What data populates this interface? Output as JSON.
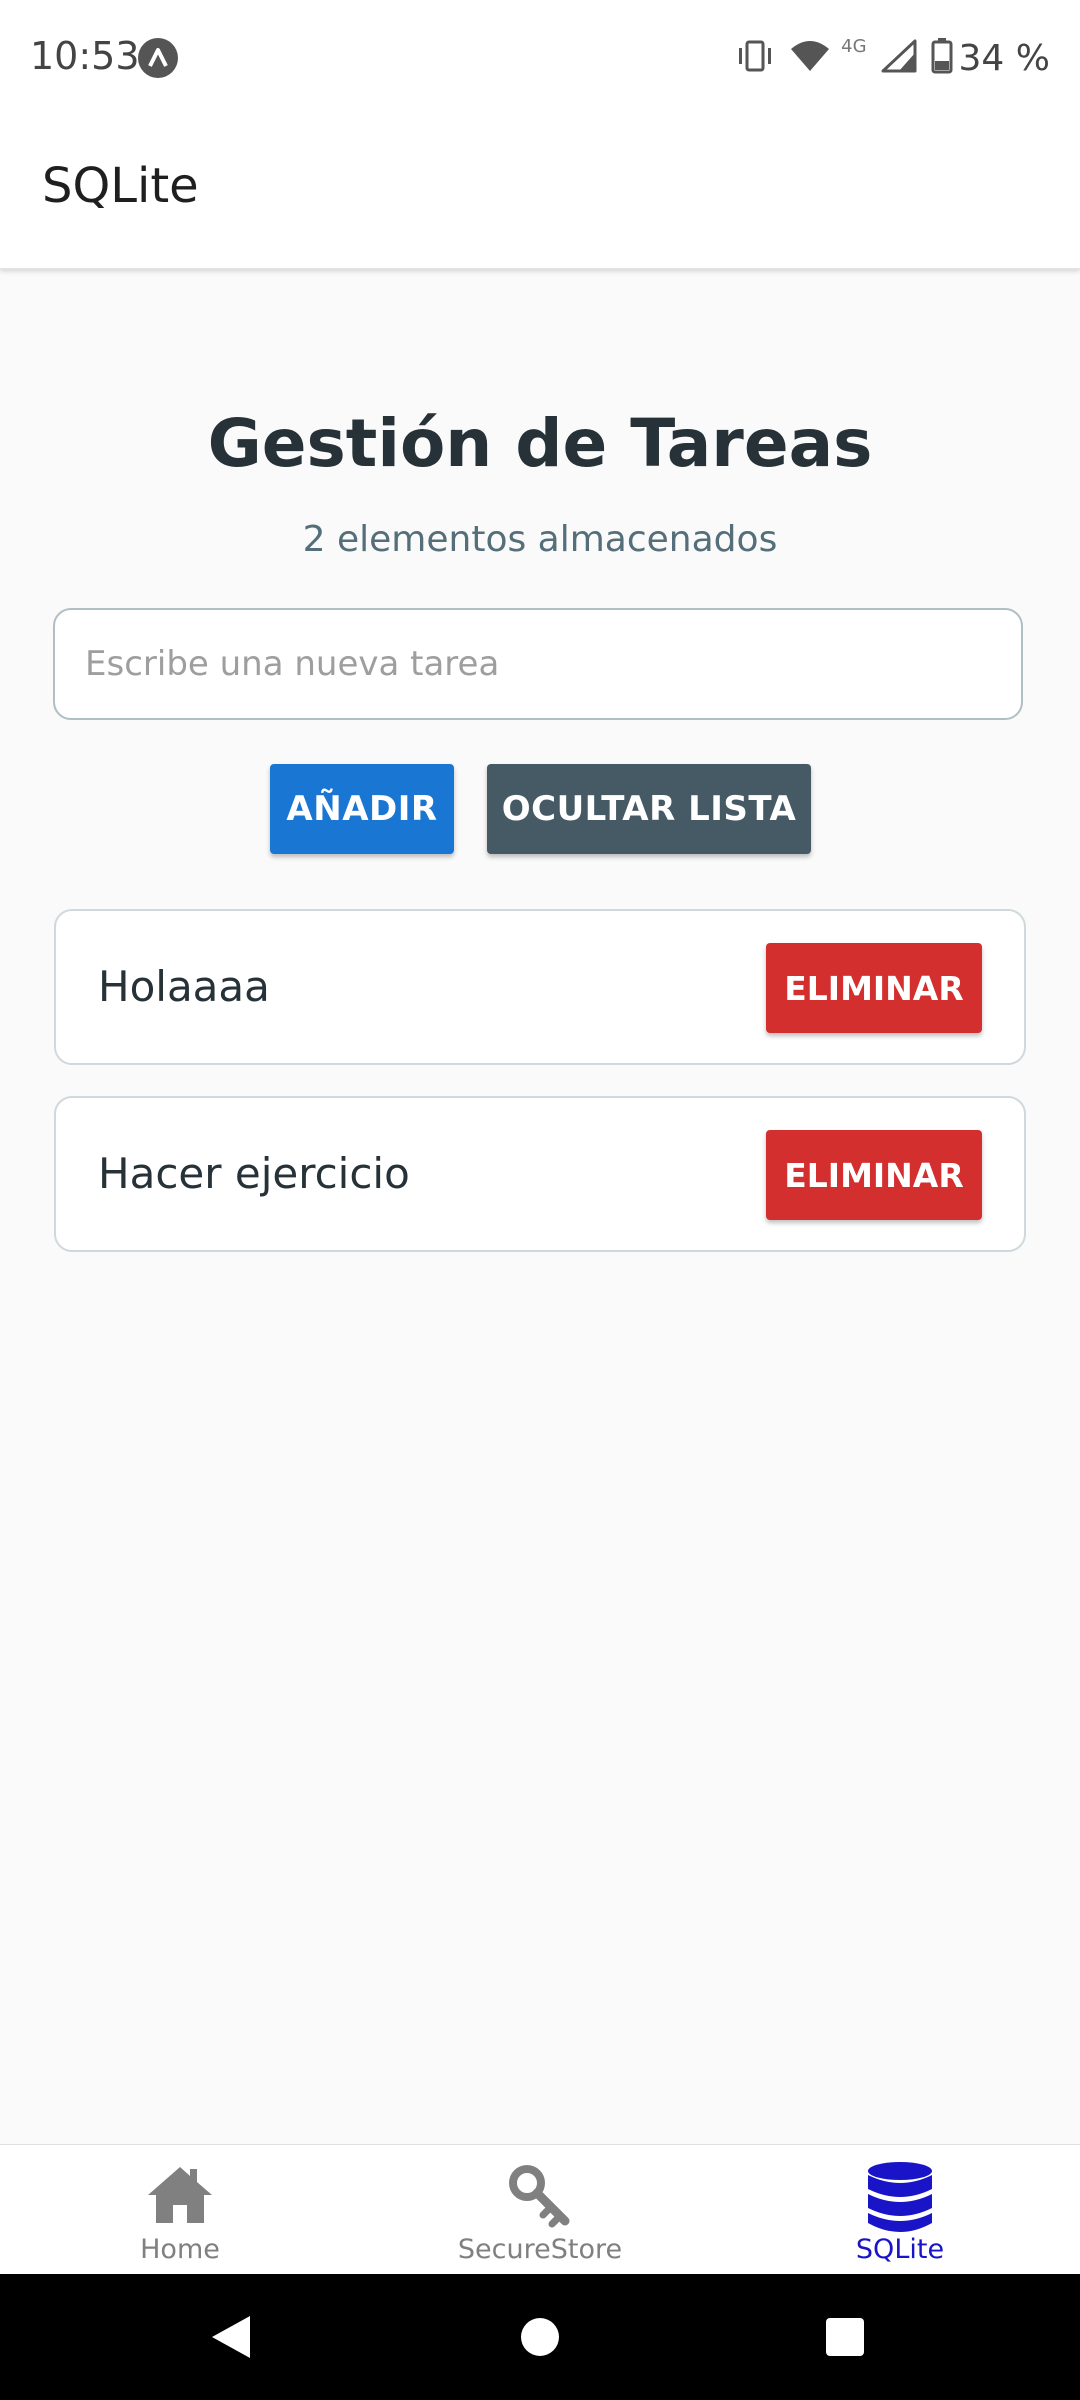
{
  "status_bar": {
    "time": "10:53",
    "network": "4G",
    "battery": "34 %"
  },
  "app_bar": {
    "title": "SQLite"
  },
  "main": {
    "title": "Gestión de Tareas",
    "subtitle": "2 elementos almacenados",
    "input": {
      "placeholder": "Escribe una nueva tarea",
      "value": ""
    },
    "add_button": "AÑADIR",
    "hide_button": "OCULTAR LISTA",
    "tasks": [
      {
        "text": "Holaaaa",
        "delete_label": "ELIMINAR"
      },
      {
        "text": "Hacer ejercicio",
        "delete_label": "ELIMINAR"
      }
    ]
  },
  "tabs": [
    {
      "label": "Home",
      "icon": "home-icon",
      "active": false
    },
    {
      "label": "SecureStore",
      "icon": "key-icon",
      "active": false
    },
    {
      "label": "SQLite",
      "icon": "database-icon",
      "active": true
    }
  ],
  "colors": {
    "primary": "#1976d2",
    "secondary": "#455a64",
    "danger": "#d32f2f",
    "active_tab": "#1a14c8",
    "inactive_tab": "#808080",
    "background": "#fafafa"
  }
}
